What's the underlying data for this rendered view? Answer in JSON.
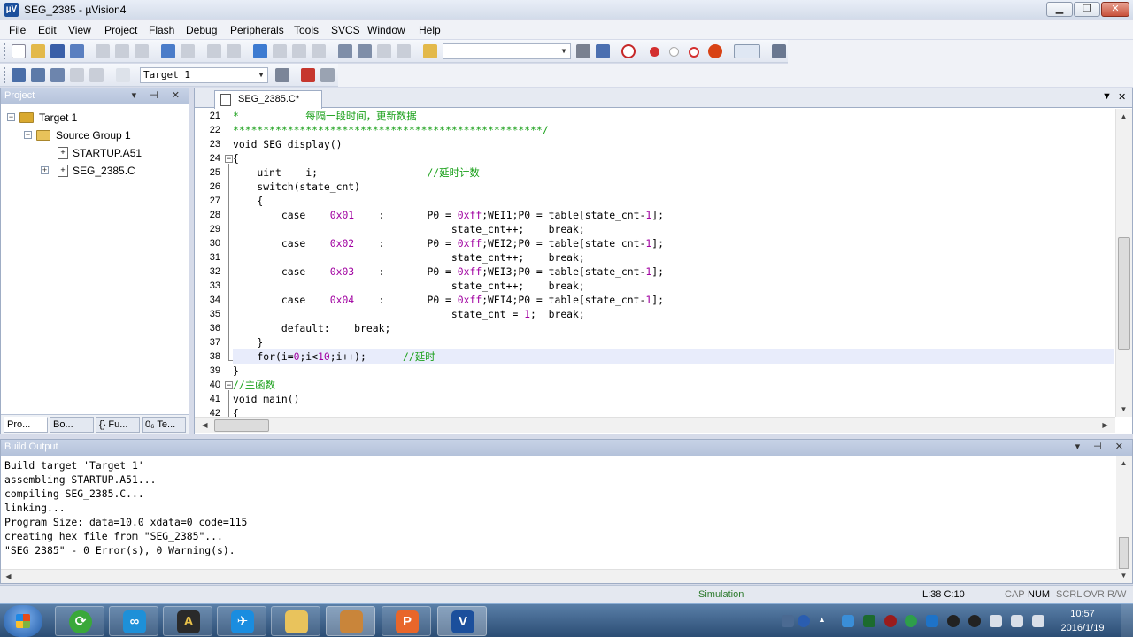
{
  "window": {
    "title": "SEG_2385  -  µVision4"
  },
  "menu": [
    "File",
    "Edit",
    "View",
    "Project",
    "Flash",
    "Debug",
    "Peripherals",
    "Tools",
    "SVCS",
    "Window",
    "Help"
  ],
  "toolbar": {
    "target_select": "Target 1"
  },
  "project_panel": {
    "title": "Project",
    "tree": {
      "target": "Target 1",
      "group": "Source Group 1",
      "files": [
        "STARTUP.A51",
        "SEG_2385.C"
      ]
    },
    "tabs": [
      "Pro...",
      "Bo...",
      "{} Fu...",
      "0₆ Te..."
    ]
  },
  "editor": {
    "active_tab": "SEG_2385.C*",
    "lines": [
      {
        "n": "21",
        "t": "*           每隔一段时间，更新数据",
        "k": "cmt"
      },
      {
        "n": "22",
        "t": "***************************************************/",
        "k": "cmt"
      },
      {
        "n": "23",
        "t": "void SEG_display()",
        "k": "code"
      },
      {
        "n": "24",
        "t": "{",
        "k": "code"
      },
      {
        "n": "25",
        "t": "    uint    i;                  //延时计数",
        "k": "code"
      },
      {
        "n": "26",
        "t": "    switch(state_cnt)",
        "k": "code"
      },
      {
        "n": "27",
        "t": "    {",
        "k": "code"
      },
      {
        "n": "28",
        "t": "        case    0x01    :       P0 = 0xff;WEI1;P0 = table[state_cnt-1];",
        "k": "code"
      },
      {
        "n": "29",
        "t": "                                    state_cnt++;    break;",
        "k": "code"
      },
      {
        "n": "30",
        "t": "        case    0x02    :       P0 = 0xff;WEI2;P0 = table[state_cnt-1];",
        "k": "code"
      },
      {
        "n": "31",
        "t": "                                    state_cnt++;    break;",
        "k": "code"
      },
      {
        "n": "32",
        "t": "        case    0x03    :       P0 = 0xff;WEI3;P0 = table[state_cnt-1];",
        "k": "code"
      },
      {
        "n": "33",
        "t": "                                    state_cnt++;    break;",
        "k": "code"
      },
      {
        "n": "34",
        "t": "        case    0x04    :       P0 = 0xff;WEI4;P0 = table[state_cnt-1];",
        "k": "code"
      },
      {
        "n": "35",
        "t": "                                    state_cnt = 1;  break;",
        "k": "code"
      },
      {
        "n": "36",
        "t": "        default:    break;",
        "k": "code"
      },
      {
        "n": "37",
        "t": "    }",
        "k": "code"
      },
      {
        "n": "38",
        "t": "    for(i=0;i<10;i++);      //延时",
        "k": "code"
      },
      {
        "n": "39",
        "t": "}",
        "k": "code"
      },
      {
        "n": "40",
        "t": "//主函数",
        "k": "cmt"
      },
      {
        "n": "41",
        "t": "void main()",
        "k": "code"
      },
      {
        "n": "42",
        "t": "{",
        "k": "code"
      }
    ],
    "current_line": "38"
  },
  "build_output": {
    "title": "Build Output",
    "lines": [
      "Build target 'Target 1'",
      "assembling STARTUP.A51...",
      "compiling SEG_2385.C...",
      "linking...",
      "Program Size: data=10.0 xdata=0 code=115",
      "creating hex file from \"SEG_2385\"...",
      "\"SEG_2385\" - 0 Error(s), 0 Warning(s)."
    ]
  },
  "status": {
    "mode": "Simulation",
    "position": "L:38 C:10",
    "caps": "CAP",
    "num": "NUM",
    "scrl": "SCRL",
    "ovr": "OVR",
    "rw": "R/W"
  },
  "taskbar": {
    "time": "10:57",
    "date": "2016/1/19"
  }
}
